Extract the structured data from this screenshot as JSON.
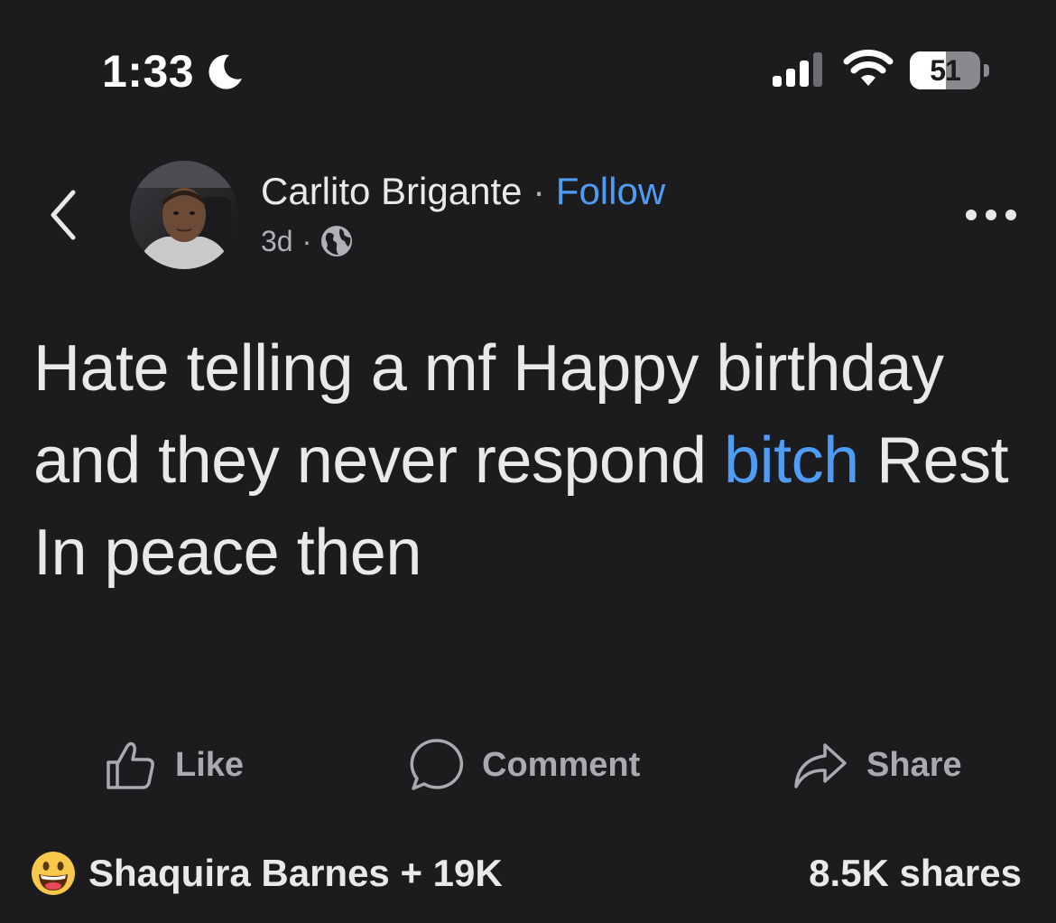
{
  "status_bar": {
    "time": "1:33",
    "battery_level": "51",
    "battery_fraction": 0.51
  },
  "post": {
    "author": "Carlito Brigante",
    "separator": " · ",
    "follow_label": "Follow",
    "timestamp": "3d",
    "meta_separator": "·",
    "audience_icon": "globe-icon",
    "body_before": "Hate telling a mf Happy birthday and they never respond ",
    "body_link": "bitch",
    "body_after": " Rest In peace then"
  },
  "actions": {
    "like_label": "Like",
    "comment_label": "Comment",
    "share_label": "Share"
  },
  "footer": {
    "reaction_icon": "grinning-face-emoji",
    "reactions_text": "Shaquira Barnes + 19K",
    "shares_text": "8.5K shares"
  },
  "colors": {
    "background": "#1c1c1e",
    "text": "#e9e9ec",
    "secondary_text": "#b0b0b5",
    "link": "#4e9cf5",
    "action_text": "#a9a9ae"
  }
}
